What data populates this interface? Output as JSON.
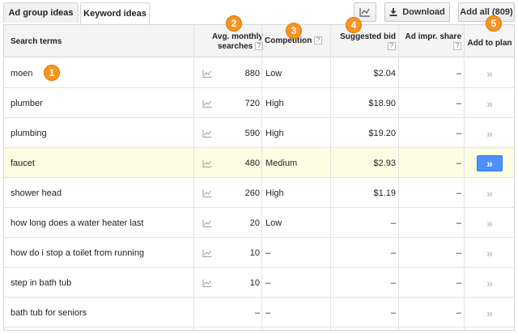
{
  "tabs": [
    {
      "label": "Ad group ideas",
      "active": false
    },
    {
      "label": "Keyword ideas",
      "active": true
    }
  ],
  "toolbar": {
    "chart_icon": "line-chart-icon",
    "download_label": "Download",
    "download_icon": "download-icon",
    "add_all_label": "Add all (809)"
  },
  "columns": {
    "search_terms": "Search terms",
    "avg_monthly_line1": "Avg. monthly",
    "avg_monthly_line2": "searches",
    "competition": "Competition",
    "suggested_bid": "Suggested bid",
    "ad_impr_share": "Ad impr. share",
    "add_to_plan": "Add to plan",
    "help_mark": "?"
  },
  "rows": [
    {
      "term": "moen",
      "searches": "880",
      "competition": "Low",
      "bid": "$2.04",
      "impr": "–",
      "highlighted": false
    },
    {
      "term": "plumber",
      "searches": "720",
      "competition": "High",
      "bid": "$18.90",
      "impr": "–",
      "highlighted": false
    },
    {
      "term": "plumbing",
      "searches": "590",
      "competition": "High",
      "bid": "$19.20",
      "impr": "–",
      "highlighted": false
    },
    {
      "term": "faucet",
      "searches": "480",
      "competition": "Medium",
      "bid": "$2.93",
      "impr": "–",
      "highlighted": true
    },
    {
      "term": "shower head",
      "searches": "260",
      "competition": "High",
      "bid": "$1.19",
      "impr": "–",
      "highlighted": false
    },
    {
      "term": "how long does a water heater last",
      "searches": "20",
      "competition": "Low",
      "bid": "–",
      "impr": "–",
      "highlighted": false
    },
    {
      "term": "how do i stop a toilet from running",
      "searches": "10",
      "competition": "–",
      "bid": "–",
      "impr": "–",
      "highlighted": false
    },
    {
      "term": "step in bath tub",
      "searches": "10",
      "competition": "–",
      "bid": "–",
      "impr": "–",
      "highlighted": false
    },
    {
      "term": "bath tub for seniors",
      "searches": "–",
      "competition": "–",
      "bid": "–",
      "impr": "–",
      "highlighted": false
    }
  ],
  "add_glyph": "»",
  "badges": [
    "1",
    "2",
    "3",
    "4",
    "5"
  ],
  "colors": {
    "accent_button": "#4d90fe",
    "highlight_row": "#fdfde4",
    "badge": "#f7941e"
  }
}
